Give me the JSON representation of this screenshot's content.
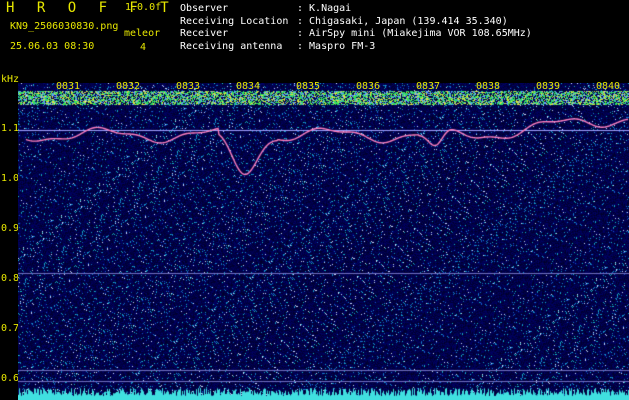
{
  "header": {
    "app_title": "H R O F F T",
    "version": "1.0.0f",
    "filename": "KN9_2506030830.png",
    "datetime": "25.06.03 08:30",
    "meteor_label": "meleor",
    "meteor_count": "4"
  },
  "info": [
    {
      "key": "Observer",
      "value": ": K.Nagai"
    },
    {
      "key": "Receiving Location",
      "value": ": Chigasaki, Japan (139.414 35.340)"
    },
    {
      "key": "Receiver",
      "value": ": AirSpy mini (Miakejima VOR 108.65MHz)"
    },
    {
      "key": "Receiving antenna",
      "value": ": Maspro FM-3"
    }
  ],
  "axis": {
    "unit": "kHz",
    "y_ticks": [
      "1.1",
      "1.0",
      "0.9",
      "0.8",
      "0.7",
      "0.6"
    ],
    "x_ticks": [
      "0831",
      "0832",
      "0833",
      "0834",
      "0835",
      "0836",
      "0837",
      "0838",
      "0839",
      "0840"
    ]
  },
  "colors": {
    "label": "#e8e800",
    "background": "#000022",
    "trace": "#ff80c0",
    "noise_band": "#40e0e0"
  }
}
